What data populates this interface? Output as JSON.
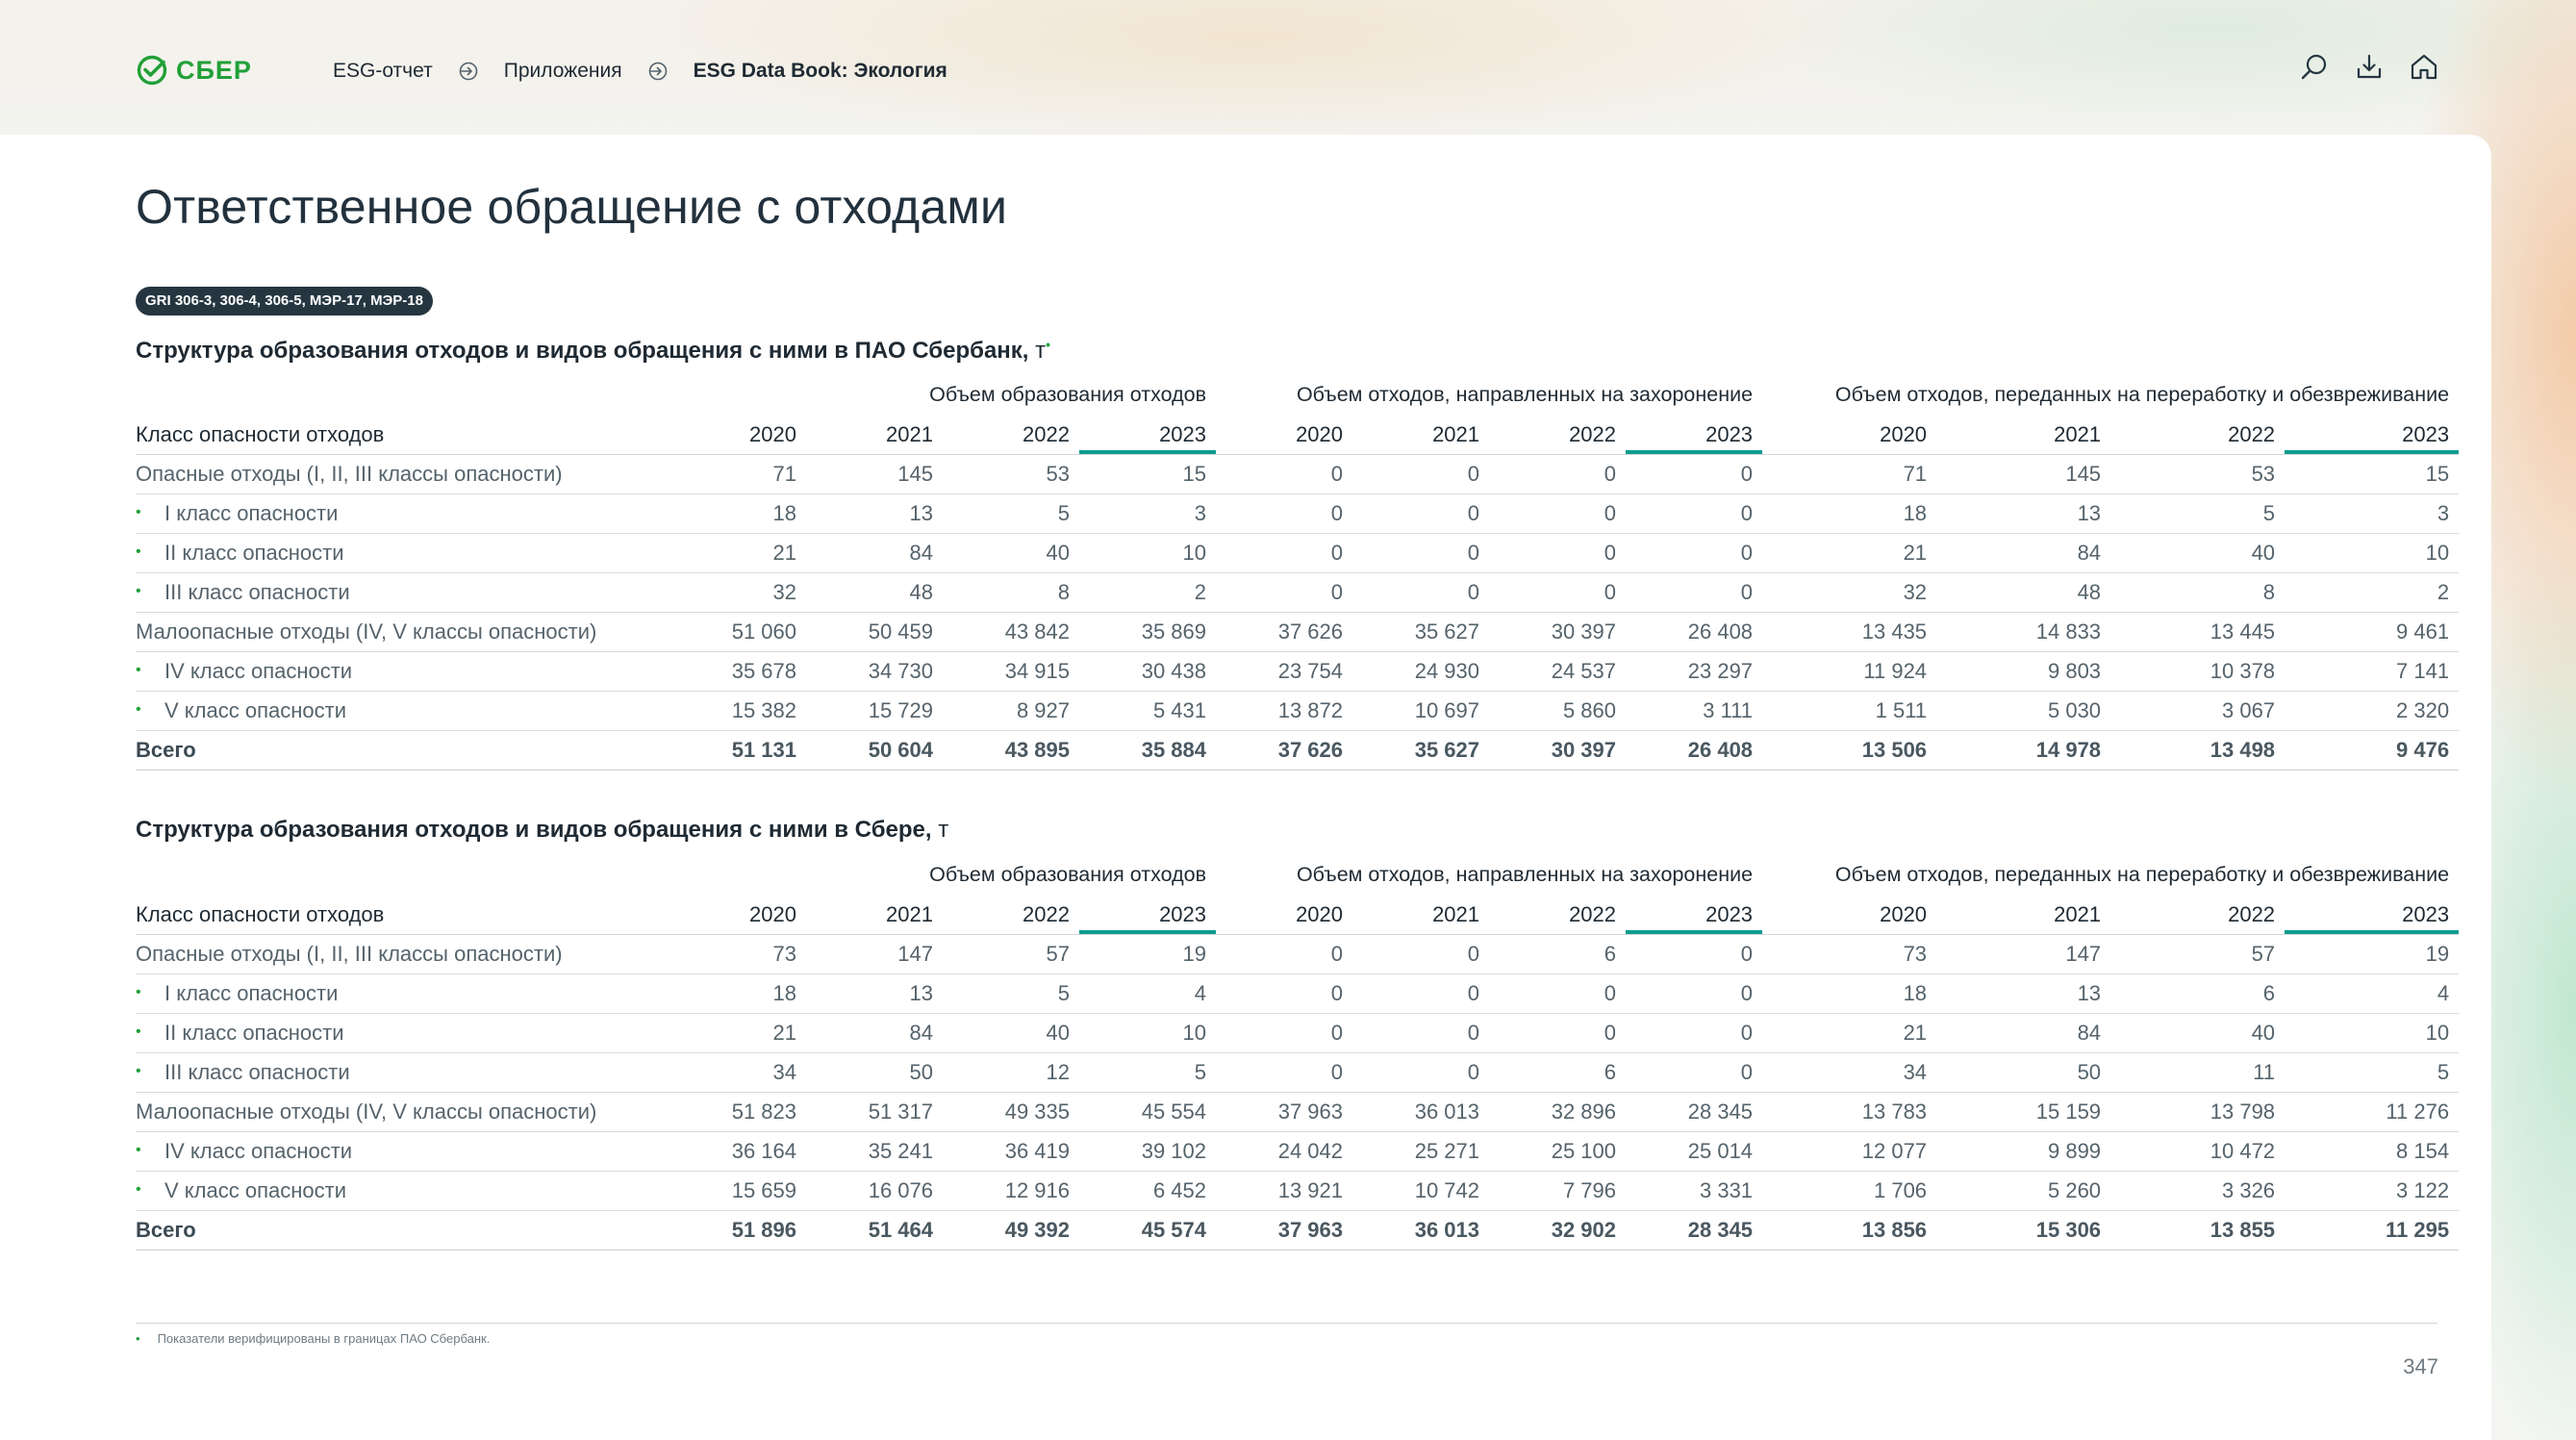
{
  "header": {
    "brand": "СБЕР",
    "breadcrumbs": [
      "ESG-отчет",
      "Приложения",
      "ESG Data Book: Экология"
    ],
    "icons": [
      "search-icon",
      "download-icon",
      "home-icon"
    ]
  },
  "page": {
    "title": "Ответственное обращение с отходами",
    "gri_badge": "GRI 306-3, 306-4, 306-5, МЭР-17, МЭР-18",
    "footnote_mark": "•",
    "footnote": "Показатели верифицированы в границах ПАО Сбербанк.",
    "page_number": "347"
  },
  "colors": {
    "brand_green": "#21a038",
    "accent_teal": "#0f9c8f",
    "badge_bg": "#253641"
  },
  "tables": [
    {
      "title": "Структура образования отходов и видов обращения с ними в ПАО Сбербанк,",
      "unit": "т",
      "footnote_mark": "•",
      "group_headers": [
        "Объем образования отходов",
        "Объем отходов, направленных на захоронение",
        "Объем отходов, переданных на переработку и обезвреживание"
      ],
      "label_header": "Класс опасности отходов",
      "years": [
        "2020",
        "2021",
        "2022",
        "2023",
        "2020",
        "2021",
        "2022",
        "2023",
        "2020",
        "2021",
        "2022",
        "2023"
      ],
      "rows": [
        {
          "kind": "group",
          "label": "Опасные отходы (I, II, III классы опасности)",
          "values": [
            "71",
            "145",
            "53",
            "15",
            "0",
            "0",
            "0",
            "0",
            "71",
            "145",
            "53",
            "15"
          ]
        },
        {
          "kind": "sub",
          "label": "I класс опасности",
          "values": [
            "18",
            "13",
            "5",
            "3",
            "0",
            "0",
            "0",
            "0",
            "18",
            "13",
            "5",
            "3"
          ]
        },
        {
          "kind": "sub",
          "label": "II класс опасности",
          "values": [
            "21",
            "84",
            "40",
            "10",
            "0",
            "0",
            "0",
            "0",
            "21",
            "84",
            "40",
            "10"
          ]
        },
        {
          "kind": "sub",
          "label": "III класс опасности",
          "values": [
            "32",
            "48",
            "8",
            "2",
            "0",
            "0",
            "0",
            "0",
            "32",
            "48",
            "8",
            "2"
          ]
        },
        {
          "kind": "group",
          "label": "Малоопасные отходы (IV, V классы опасности)",
          "values": [
            "51 060",
            "50 459",
            "43 842",
            "35 869",
            "37 626",
            "35 627",
            "30 397",
            "26 408",
            "13 435",
            "14 833",
            "13 445",
            "9 461"
          ]
        },
        {
          "kind": "sub",
          "label": "IV класс опасности",
          "values": [
            "35 678",
            "34 730",
            "34 915",
            "30 438",
            "23 754",
            "24 930",
            "24 537",
            "23 297",
            "11 924",
            "9 803",
            "10 378",
            "7 141"
          ]
        },
        {
          "kind": "sub",
          "label": "V класс опасности",
          "values": [
            "15 382",
            "15 729",
            "8 927",
            "5 431",
            "13 872",
            "10 697",
            "5 860",
            "3 111",
            "1 511",
            "5 030",
            "3 067",
            "2 320"
          ]
        },
        {
          "kind": "total",
          "label": "Всего",
          "values": [
            "51 131",
            "50 604",
            "43 895",
            "35 884",
            "37 626",
            "35 627",
            "30 397",
            "26 408",
            "13 506",
            "14 978",
            "13 498",
            "9 476"
          ]
        }
      ]
    },
    {
      "title": "Структура образования отходов и видов обращения с ними в Сбере,",
      "unit": "т",
      "footnote_mark": "",
      "group_headers": [
        "Объем образования отходов",
        "Объем отходов, направленных на захоронение",
        "Объем отходов, переданных на переработку и обезвреживание"
      ],
      "label_header": "Класс опасности отходов",
      "years": [
        "2020",
        "2021",
        "2022",
        "2023",
        "2020",
        "2021",
        "2022",
        "2023",
        "2020",
        "2021",
        "2022",
        "2023"
      ],
      "rows": [
        {
          "kind": "group",
          "label": "Опасные отходы (I, II, III классы опасности)",
          "values": [
            "73",
            "147",
            "57",
            "19",
            "0",
            "0",
            "6",
            "0",
            "73",
            "147",
            "57",
            "19"
          ]
        },
        {
          "kind": "sub",
          "label": "I класс опасности",
          "values": [
            "18",
            "13",
            "5",
            "4",
            "0",
            "0",
            "0",
            "0",
            "18",
            "13",
            "6",
            "4"
          ]
        },
        {
          "kind": "sub",
          "label": "II класс опасности",
          "values": [
            "21",
            "84",
            "40",
            "10",
            "0",
            "0",
            "0",
            "0",
            "21",
            "84",
            "40",
            "10"
          ]
        },
        {
          "kind": "sub",
          "label": "III класс опасности",
          "values": [
            "34",
            "50",
            "12",
            "5",
            "0",
            "0",
            "6",
            "0",
            "34",
            "50",
            "11",
            "5"
          ]
        },
        {
          "kind": "group",
          "label": "Малоопасные отходы (IV, V классы опасности)",
          "values": [
            "51 823",
            "51 317",
            "49 335",
            "45 554",
            "37 963",
            "36 013",
            "32 896",
            "28 345",
            "13 783",
            "15 159",
            "13 798",
            "11 276"
          ]
        },
        {
          "kind": "sub",
          "label": "IV класс опасности",
          "values": [
            "36 164",
            "35 241",
            "36 419",
            "39 102",
            "24 042",
            "25 271",
            "25 100",
            "25 014",
            "12 077",
            "9 899",
            "10 472",
            "8 154"
          ]
        },
        {
          "kind": "sub",
          "label": "V класс опасности",
          "values": [
            "15 659",
            "16 076",
            "12 916",
            "6 452",
            "13 921",
            "10 742",
            "7 796",
            "3 331",
            "1 706",
            "5 260",
            "3 326",
            "3 122"
          ]
        },
        {
          "kind": "total",
          "label": "Всего",
          "values": [
            "51 896",
            "51 464",
            "49 392",
            "45 574",
            "37 963",
            "36 013",
            "32 902",
            "28 345",
            "13 856",
            "15 306",
            "13 855",
            "11 295"
          ]
        }
      ]
    }
  ]
}
